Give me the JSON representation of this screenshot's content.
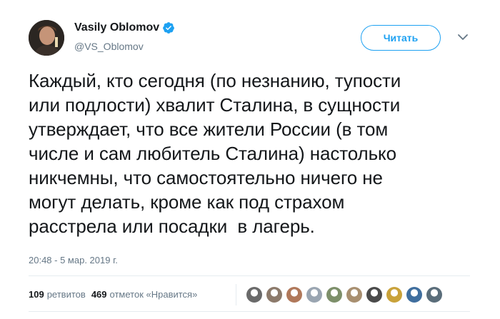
{
  "author": {
    "name": "Vasily Oblomov",
    "handle": "@VS_Oblomov",
    "verified_icon": "verified-badge-icon"
  },
  "follow_button": {
    "label": "Читать"
  },
  "tweet": {
    "text": "Каждый, кто сегодня (по незнанию, тупости\nили подлости) хвалит Сталина, в сущности\nутверждает, что все жители России (в том\nчисле и сам любитель Сталина) настолько\nникчемны, что самостоятельно ничего не\nмогут делать, кроме как под страхом\nрасстрела или посадки  в лагерь.",
    "timestamp": "20:48 - 5 мар. 2019 г."
  },
  "stats": {
    "retweets_count": "109",
    "retweets_label": "ретвитов",
    "likes_count": "469",
    "likes_label": "отметок «Нравится»"
  },
  "likers": [
    {
      "color": "#6a6a6a"
    },
    {
      "color": "#8c7a6b"
    },
    {
      "color": "#b0785a"
    },
    {
      "color": "#9aa5b1"
    },
    {
      "color": "#7d8f6a"
    },
    {
      "color": "#a88f70"
    },
    {
      "color": "#4a4a4a"
    },
    {
      "color": "#c9a23a"
    },
    {
      "color": "#3f6e9e"
    },
    {
      "color": "#5a6d7a"
    }
  ],
  "colors": {
    "accent": "#1da1f2",
    "text": "#14171a",
    "secondary": "#657786"
  }
}
